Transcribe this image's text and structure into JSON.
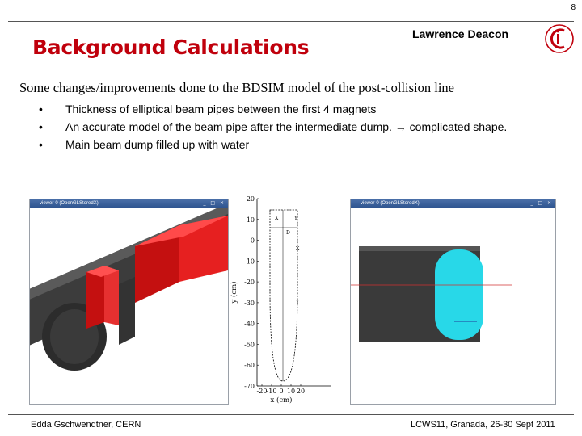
{
  "slide_number": "8",
  "title": "Background Calculations",
  "presenter": "Lawrence Deacon",
  "intro": "Some changes/improvements done to the BDSIM model of the post-collision line",
  "bullets": [
    {
      "marker": "•",
      "text": "Thickness of elliptical beam pipes between the first 4 magnets"
    },
    {
      "marker": "•",
      "text": "An accurate model of the beam pipe after the intermediate dump. → complicated shape."
    },
    {
      "marker": "•",
      "text": "Main beam dump filled up with water"
    }
  ],
  "left_window": {
    "title": "viewer-0 (OpenGLStoredX)",
    "buttons": "_ □ ×"
  },
  "right_window": {
    "title": "viewer-0 (OpenGLStoredX)",
    "buttons": "_ □ ×"
  },
  "plot": {
    "ylabel": "y (cm)",
    "xlabel": "x (cm)",
    "y_ticks": [
      "20",
      "10",
      "0",
      "10",
      "-20",
      "-30",
      "-40",
      "-50",
      "-60",
      "-70"
    ],
    "x_ticks": [
      "-20",
      "-10",
      "0",
      "10",
      "20"
    ],
    "annotations": [
      "X",
      "Y",
      "D",
      "X",
      "Y"
    ]
  },
  "footer": {
    "left": "Edda Gschwendtner, CERN",
    "right": "LCWS11, Granada, 26-30 Sept 2011"
  },
  "colors": {
    "title": "#c0000c",
    "magnet": "#e01010",
    "pipe": "#3a3a3a",
    "dump_water": "#28d8e8"
  }
}
